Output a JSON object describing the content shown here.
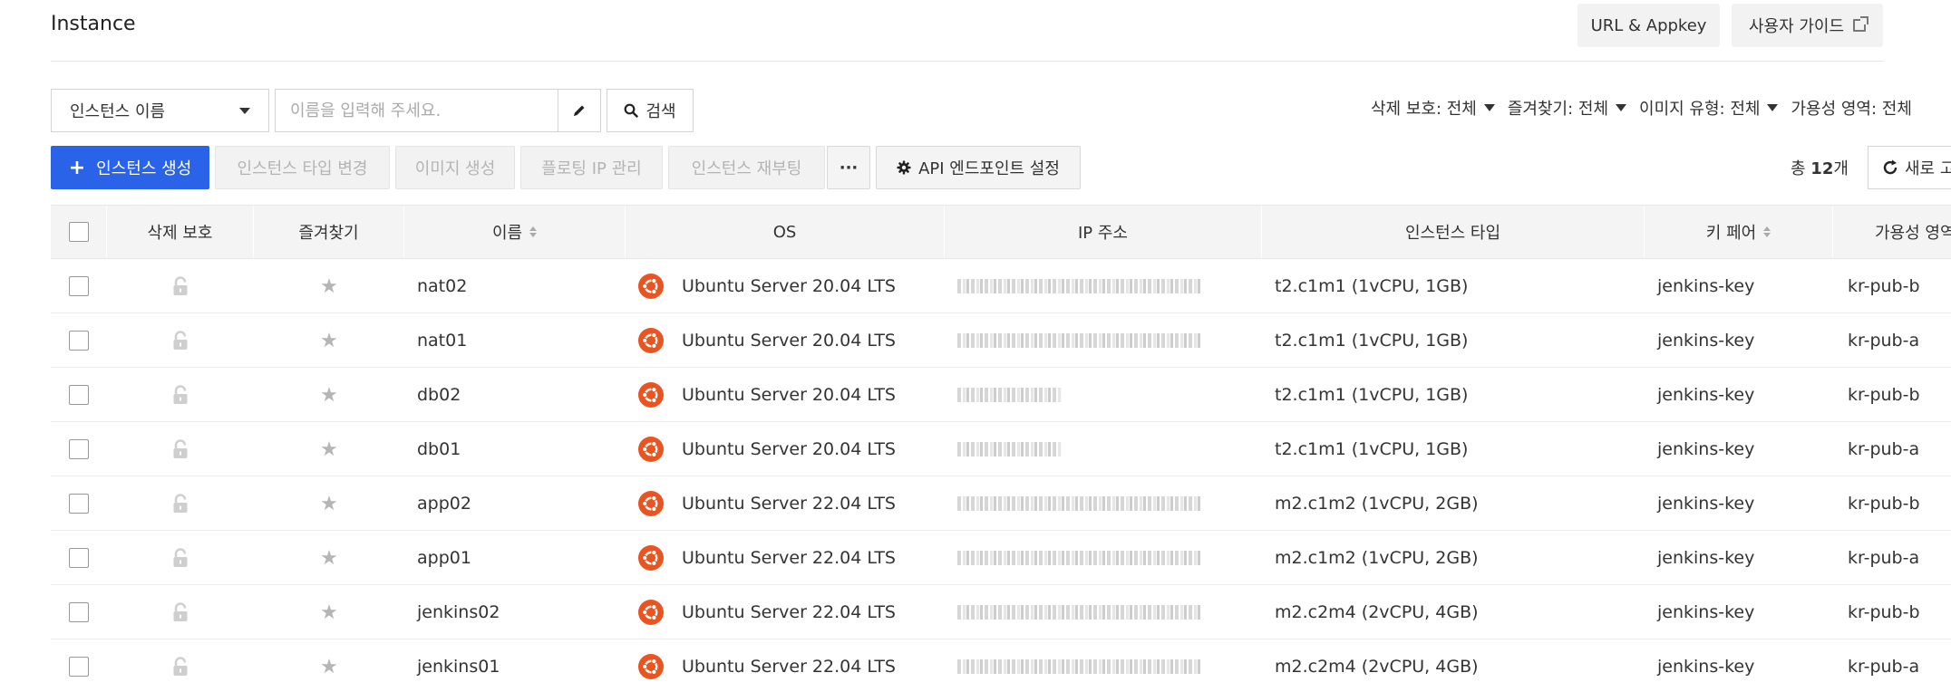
{
  "header": {
    "title": "Instance",
    "url_appkey_label": "URL & Appkey",
    "guide_label": "사용자 가이드"
  },
  "search": {
    "select_value": "인스턴스 이름",
    "placeholder": "이름을 입력해 주세요.",
    "search_label": "검색"
  },
  "filters": [
    {
      "label": "삭제 보호: 전체"
    },
    {
      "label": "즐겨찾기: 전체"
    },
    {
      "label": "이미지 유형: 전체"
    },
    {
      "label": "가용성 영역: 전체"
    }
  ],
  "toolbar": {
    "create_label": "인스턴스 생성",
    "change_type_label": "인스턴스 타입 변경",
    "create_image_label": "이미지 생성",
    "floating_ip_label": "플로팅 IP 관리",
    "reboot_label": "인스턴스 재부팅",
    "more_label": "···",
    "api_label": "API 엔드포인트 설정",
    "total_prefix": "총",
    "total_count": "12",
    "total_suffix": "개",
    "refresh_label": "새로 고침"
  },
  "table": {
    "columns": {
      "delete_protect": "삭제 보호",
      "favorite": "즐겨찾기",
      "name": "이름",
      "os": "OS",
      "ip": "IP 주소",
      "type": "인스턴스 타입",
      "keypair": "키 페어",
      "az": "가용성 영역"
    },
    "rows": [
      {
        "name": "nat02",
        "os": "Ubuntu Server 20.04 LTS",
        "type": "t2.c1m1 (1vCPU, 1GB)",
        "keypair": "jenkins-key",
        "az": "kr-pub-b"
      },
      {
        "name": "nat01",
        "os": "Ubuntu Server 20.04 LTS",
        "type": "t2.c1m1 (1vCPU, 1GB)",
        "keypair": "jenkins-key",
        "az": "kr-pub-a"
      },
      {
        "name": "db02",
        "os": "Ubuntu Server 20.04 LTS",
        "type": "t2.c1m1 (1vCPU, 1GB)",
        "keypair": "jenkins-key",
        "az": "kr-pub-b"
      },
      {
        "name": "db01",
        "os": "Ubuntu Server 20.04 LTS",
        "type": "t2.c1m1 (1vCPU, 1GB)",
        "keypair": "jenkins-key",
        "az": "kr-pub-a"
      },
      {
        "name": "app02",
        "os": "Ubuntu Server 22.04 LTS",
        "type": "m2.c1m2 (1vCPU, 2GB)",
        "keypair": "jenkins-key",
        "az": "kr-pub-b"
      },
      {
        "name": "app01",
        "os": "Ubuntu Server 22.04 LTS",
        "type": "m2.c1m2 (1vCPU, 2GB)",
        "keypair": "jenkins-key",
        "az": "kr-pub-a"
      },
      {
        "name": "jenkins02",
        "os": "Ubuntu Server 22.04 LTS",
        "type": "m2.c2m4 (2vCPU, 4GB)",
        "keypair": "jenkins-key",
        "az": "kr-pub-b"
      },
      {
        "name": "jenkins01",
        "os": "Ubuntu Server 22.04 LTS",
        "type": "m2.c2m4 (2vCPU, 4GB)",
        "keypair": "jenkins-key",
        "az": "kr-pub-a"
      }
    ]
  },
  "colors": {
    "primary": "#2a62e8",
    "ubuntu": "#e95420"
  },
  "icons": {
    "lock": "lock-icon",
    "star": "star-icon",
    "os": "ubuntu-icon"
  }
}
